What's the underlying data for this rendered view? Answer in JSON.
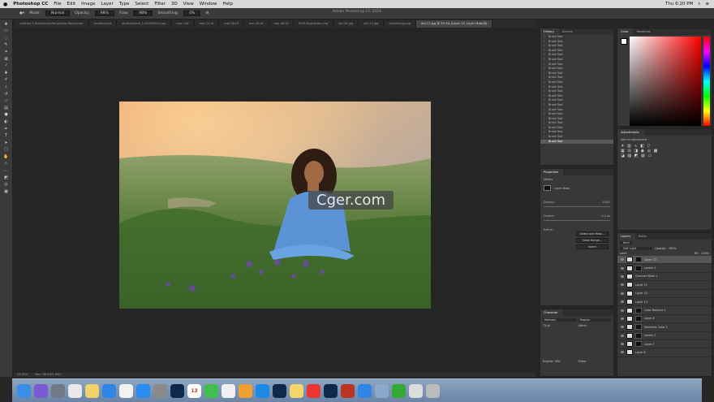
{
  "menubar": {
    "apple": "",
    "app_name": "Photoshop CC",
    "items": [
      "File",
      "Edit",
      "Image",
      "Layer",
      "Type",
      "Select",
      "Filter",
      "3D",
      "View",
      "Window",
      "Help"
    ],
    "clock": "Thu 6:20 PM"
  },
  "options": {
    "mode_label": "Mode:",
    "mode_value": "Normal",
    "opacity_label": "Opacity:",
    "opacity_value": "98%",
    "flow_label": "Flow:",
    "flow_value": "98%",
    "smoothing_label": "Smoothing:",
    "smoothing_value": "0%",
    "window_title": "Adobe Photoshop CC 2018"
  },
  "tabs": [
    "Untitled-1-Recovered-Recovered-Recovered",
    "Untitled.psd",
    "shutterstock_1234558013.jpg",
    "mer-3.tif",
    "mer-14.tif",
    "mer-28.tif",
    "mer-30.tif",
    "mer-36.tif",
    "RGB Illustration.png",
    "old-28.jpg",
    "old-13.jpg",
    "colorfixing.png",
    "old-17.jpg @ 33.3% (Layer 15, Layer Mask/8)"
  ],
  "watermark": "Cger.com",
  "status": {
    "zoom": "33.33%",
    "doc": "Doc: 88.5M/1.99G"
  },
  "history": {
    "tabs": [
      "History",
      "Actions"
    ],
    "items": [
      "Brush Tool",
      "Brush Tool",
      "Brush Tool",
      "Brush Tool",
      "Brush Tool",
      "Brush Tool",
      "Brush Tool",
      "Brush Tool",
      "Brush Tool",
      "Brush Tool",
      "Brush Tool",
      "Brush Tool",
      "Brush Tool",
      "Brush Tool",
      "Brush Tool",
      "Brush Tool",
      "Brush Tool",
      "Brush Tool",
      "Brush Tool",
      "Brush Tool",
      "Brush Tool",
      "Brush Tool",
      "Brush Tool",
      "Brush Tool"
    ]
  },
  "properties": {
    "tabs": [
      "Properties"
    ],
    "kind": "Masks",
    "mask_label": "Layer Mask",
    "density_label": "Density:",
    "density_value": "100%",
    "feather_label": "Feather:",
    "feather_value": "0.0 px",
    "refine_label": "Refine:",
    "buttons": [
      "Select and Mask...",
      "Color Range...",
      "Invert"
    ]
  },
  "character": {
    "tabs": [
      "Character"
    ],
    "font": "Raleway",
    "style": "Regular",
    "size": "72 pt",
    "leading": "(Auto)",
    "language": "English: USA",
    "aa": "Sharp"
  },
  "color": {
    "tabs": [
      "Color",
      "Swatches"
    ],
    "fg": "#ffffff",
    "bg": "#000000",
    "hue": "#ff0000"
  },
  "adjustments": {
    "tabs": [
      "Adjustments"
    ],
    "label": "Add an adjustment"
  },
  "layers": {
    "tabs": [
      "Layers",
      "Paths"
    ],
    "kind": "Kind",
    "blend": "Soft Light",
    "opacity_label": "Opacity:",
    "opacity_value": "100%",
    "lock_label": "Lock:",
    "fill_label": "Fill:",
    "fill_value": "100%",
    "items": [
      {
        "name": "Layer 15",
        "selected": true,
        "mask": true
      },
      {
        "name": "Levels 4",
        "selected": false,
        "mask": true
      },
      {
        "name": "Channel Mixer 1",
        "selected": false,
        "mask": false
      },
      {
        "name": "Layer 11",
        "selected": false,
        "mask": false
      },
      {
        "name": "Layer 10",
        "selected": false,
        "mask": false
      },
      {
        "name": "Layer 13",
        "selected": false,
        "mask": false
      },
      {
        "name": "Color Balance 1",
        "selected": false,
        "mask": true
      },
      {
        "name": "Layer 8",
        "selected": false,
        "mask": true
      },
      {
        "name": "Selective Color 1",
        "selected": false,
        "mask": true
      },
      {
        "name": "Levels 3",
        "selected": false,
        "mask": true
      },
      {
        "name": "Layer 7",
        "selected": false,
        "mask": true
      },
      {
        "name": "Layer 6",
        "selected": false,
        "mask": false
      }
    ]
  },
  "dock": {
    "icons": [
      "finder",
      "siri",
      "launchpad",
      "chrome",
      "notes",
      "safari",
      "photos",
      "app-store",
      "system-prefs",
      "photoshop",
      "calendar",
      "facetime",
      "itunes",
      "books",
      "wunderlist",
      "photoshop-2",
      "notes-app",
      "ebay",
      "lightroom",
      "acrobat",
      "safari-2",
      "preview",
      "camtasia",
      "stacks",
      "trash"
    ],
    "calendar_day": "13"
  }
}
